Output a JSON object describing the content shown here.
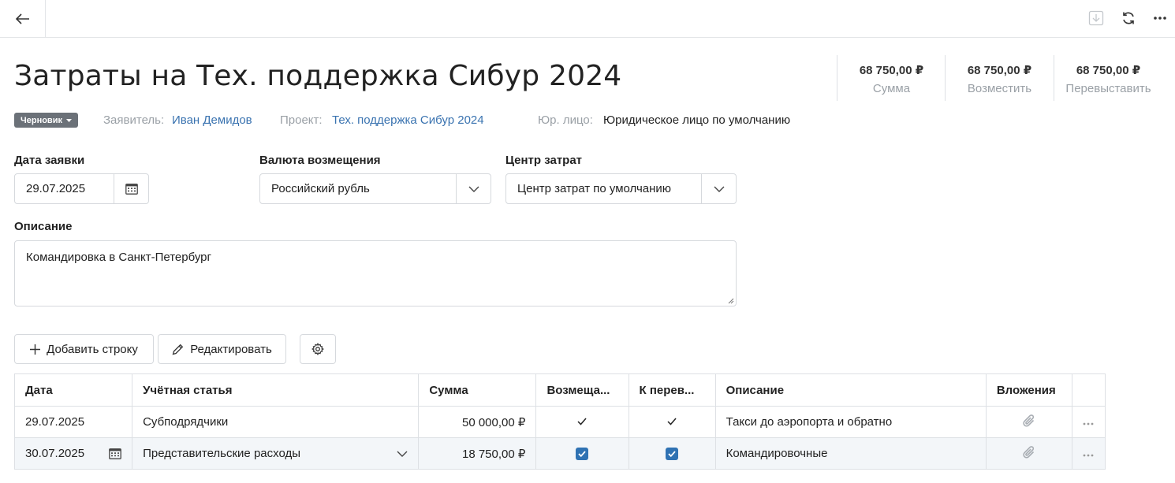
{
  "topbar": {
    "back_icon": "arrow-left-icon",
    "actions": [
      "download-icon",
      "refresh-icon",
      "more-icon"
    ]
  },
  "header": {
    "title": "Затраты на Тех. поддержка Сибур 2024"
  },
  "summary": [
    {
      "value": "68 750,00 ₽",
      "label": "Сумма"
    },
    {
      "value": "68 750,00 ₽",
      "label": "Возместить"
    },
    {
      "value": "68 750,00 ₽",
      "label": "Перевыставить"
    }
  ],
  "meta": {
    "status": "Черновик",
    "applicant_label": "Заявитель:",
    "applicant": "Иван Демидов",
    "project_label": "Проект:",
    "project": "Тех. поддержка Сибур 2024",
    "legal_label": "Юр. лицо:",
    "legal": "Юридическое лицо по умолчанию"
  },
  "form": {
    "date_label": "Дата заявки",
    "date_value": "29.07.2025",
    "currency_label": "Валюта возмещения",
    "currency_value": "Российский рубль",
    "cost_center_label": "Центр затрат",
    "cost_center_value": "Центр затрат по умолчанию",
    "description_label": "Описание",
    "description_value": "Командировка в Санкт-Петербург"
  },
  "toolbar": {
    "add_row": "Добавить строку",
    "edit": "Редактировать"
  },
  "table": {
    "columns": [
      "Дата",
      "Учётная статья",
      "Сумма",
      "Возмеща...",
      "К перев...",
      "Описание",
      "Вложения"
    ],
    "rows": [
      {
        "date": "29.07.2025",
        "article": "Субподрядчики",
        "amount": "50 000,00 ₽",
        "reimburse": true,
        "rebill": true,
        "description": "Такси до аэропорта и обратно"
      },
      {
        "date": "30.07.2025",
        "article": "Представительские расходы",
        "amount": "18 750,00 ₽",
        "reimburse": true,
        "rebill": true,
        "description": "Командировочные"
      }
    ]
  },
  "colors": {
    "link": "#3a73b0",
    "badge": "#6b7178",
    "checkbox": "#2f72b3"
  }
}
